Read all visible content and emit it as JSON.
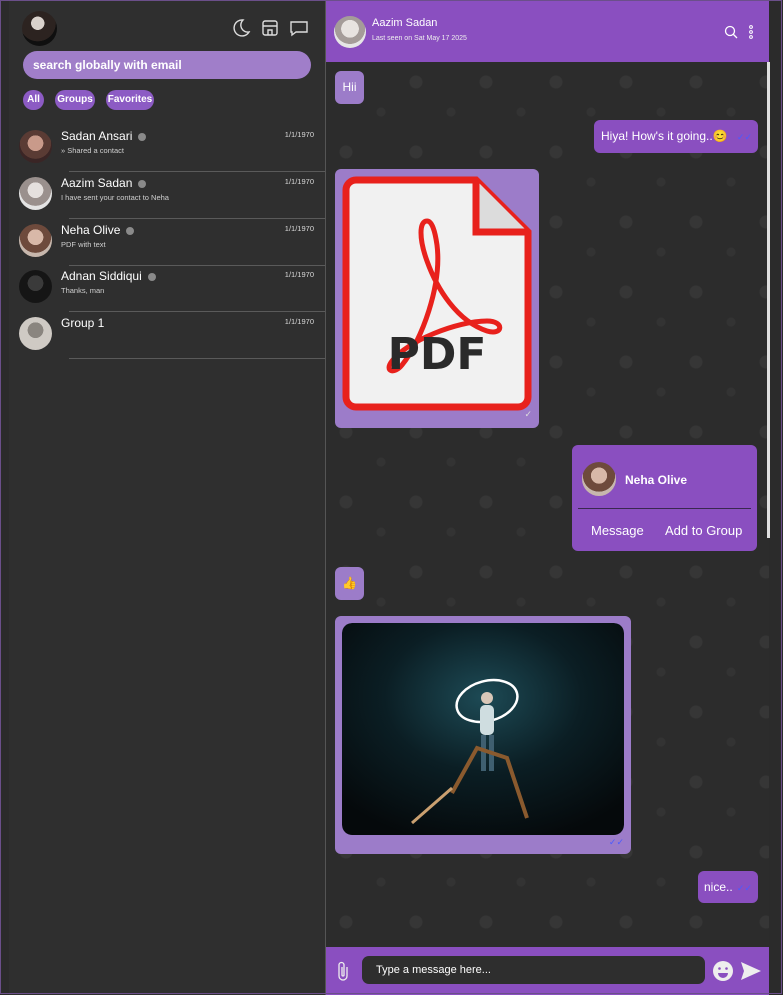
{
  "sidebar": {
    "search_placeholder": "search globally with email",
    "filters": [
      "All",
      "Groups",
      "Favorites"
    ],
    "contacts": [
      {
        "name": "Sadan Ansari",
        "preview": "» Shared a contact",
        "date": "1/1/1970"
      },
      {
        "name": "Aazim Sadan",
        "preview": "I have sent your contact to Neha",
        "date": "1/1/1970"
      },
      {
        "name": "Neha Olive",
        "preview": "PDF with text",
        "date": "1/1/1970"
      },
      {
        "name": "Adnan Siddiqui",
        "preview": "Thanks, man",
        "date": "1/1/1970"
      },
      {
        "name": "Group 1",
        "preview": "",
        "date": "1/1/1970"
      }
    ]
  },
  "chat": {
    "name": "Aazim Sadan",
    "last_seen": "Last seen on Sat May 17 2025",
    "messages": {
      "m1": "Hii",
      "m2": "Hiya! How's it going..😊",
      "pdf_label": "PDF",
      "contact_card_name": "Neha Olive",
      "contact_card_message": "Message",
      "contact_card_add": "Add to Group",
      "m5": "👍",
      "m7": "nice.."
    },
    "composer_placeholder": "Type a message here..."
  },
  "colors": {
    "accent": "#8a4fc0",
    "incoming": "#9c7cc9",
    "pdf_red": "#e8211c"
  }
}
